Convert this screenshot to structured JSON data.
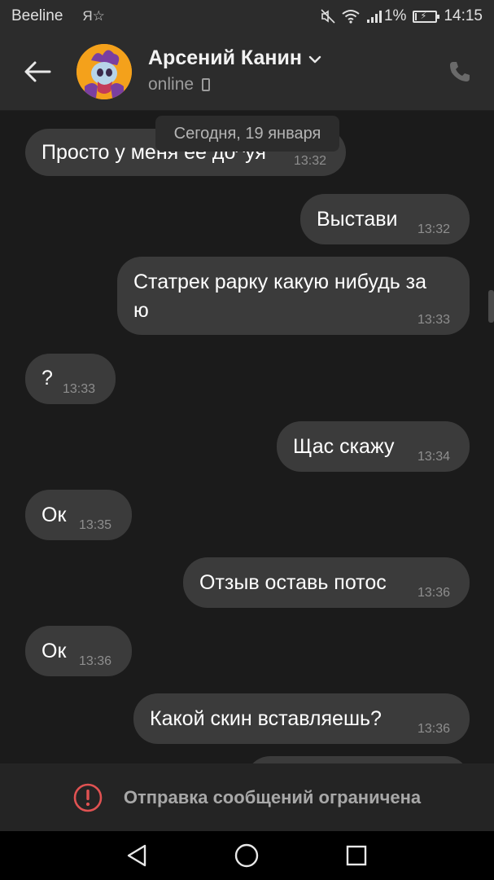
{
  "status_bar": {
    "carrier": "Beeline",
    "vk_label": "Я☆",
    "battery_percent": "1%",
    "battery_level": 0.01,
    "time": "14:15"
  },
  "header": {
    "contact_name": "Арсений Канин",
    "status": "online",
    "icons": {
      "back": "arrow-left-icon",
      "avatar": "avatar",
      "dropdown": "chevron-down-icon",
      "device": "mobile-device-icon",
      "call": "phone-icon"
    }
  },
  "chat": {
    "date_separator": "Сегодня, 19 января",
    "messages": [
      {
        "direction": "incoming",
        "text": "Просто у меня ее до^уя",
        "time": "13:32"
      },
      {
        "direction": "outgoing",
        "text": "Выстави",
        "time": "13:32"
      },
      {
        "direction": "outgoing",
        "text": "Статрек рарку какую нибудь за\nю",
        "time": "13:33"
      },
      {
        "direction": "incoming",
        "text": "?",
        "time": "13:33"
      },
      {
        "direction": "outgoing",
        "text": "Щас скажу",
        "time": "13:34"
      },
      {
        "direction": "incoming",
        "text": "Ок",
        "time": "13:35"
      },
      {
        "direction": "outgoing",
        "text": "Отзыв оставь потос",
        "time": "13:36"
      },
      {
        "direction": "incoming",
        "text": "Ок",
        "time": "13:36"
      },
      {
        "direction": "outgoing",
        "text": "Какой скин вставляешь?",
        "time": "13:36"
      }
    ]
  },
  "restriction": {
    "message": "Отправка сообщений ограничена",
    "icon": "warning-circle-icon",
    "color": "#e05252"
  },
  "navbar": {
    "icons": [
      "back-triangle-icon",
      "home-circle-icon",
      "recents-square-icon"
    ]
  },
  "colors": {
    "background": "#1b1b1b",
    "bubble": "#3b3b3b",
    "header": "#2c2c2c"
  }
}
